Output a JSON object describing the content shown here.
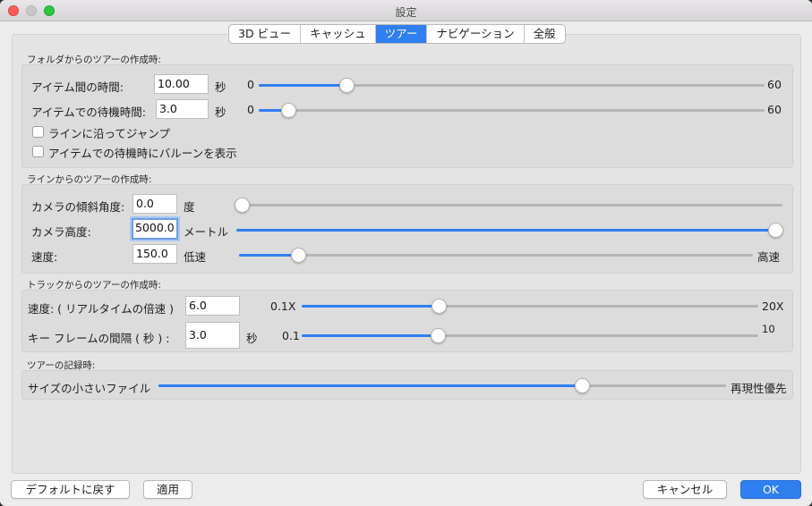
{
  "window": {
    "title": "設定"
  },
  "tabs": [
    {
      "label": "3D ビュー",
      "active": false
    },
    {
      "label": "キャッシュ",
      "active": false
    },
    {
      "label": "ツアー",
      "active": true
    },
    {
      "label": "ナビゲーション",
      "active": false
    },
    {
      "label": "全般",
      "active": false
    }
  ],
  "folder_section": {
    "title": "フォルダからのツアーの作成時:",
    "time_between": {
      "label": "アイテム間の時間:",
      "value": "10.00",
      "unit": "秒",
      "min": "0",
      "max": "60",
      "level": 10
    },
    "wait_time": {
      "label": "アイテムでの待機時間:",
      "value": "3.0",
      "unit": "秒",
      "min": "0",
      "max": "60",
      "level": 3
    },
    "jump_along_line": {
      "label": "ラインに沿ってジャンプ",
      "checked": false
    },
    "show_balloon": {
      "label": "アイテムでの待機時にバルーンを表示",
      "checked": false
    }
  },
  "line_section": {
    "title": "ラインからのツアーの作成時:",
    "tilt": {
      "label": "カメラの傾斜角度:",
      "value": "0.0",
      "unit": "度",
      "level": 0
    },
    "altitude": {
      "label": "カメラ高度:",
      "value": "5000.0",
      "unit": "メートル",
      "level": 1
    },
    "speed": {
      "label": "速度:",
      "value": "150.0",
      "min": "低速",
      "max": "高速",
      "level": 0.12
    }
  },
  "track_section": {
    "title": "トラックからのツアーの作成時:",
    "speed": {
      "label": "速度: ( リアルタイムの倍速 )",
      "value": "6.0",
      "min": "0.1X",
      "max": "20X",
      "level": 0.3
    },
    "keyframe": {
      "label": "キー フレームの間隔 ( 秒 ) :",
      "value": "3.0",
      "unit": "秒",
      "min": "0.1",
      "max": "10",
      "level": 0.3
    }
  },
  "record_section": {
    "title": "ツアーの記録時:",
    "quality": {
      "min": "サイズの小さいファイル",
      "max": "再現性優先",
      "level": 0.75
    }
  },
  "buttons": {
    "defaults": "デフォルトに戻す",
    "apply": "適用",
    "cancel": "キャンセル",
    "ok": "OK"
  },
  "colors": {
    "accent": "#2f7ff1",
    "close": "#fd5f57",
    "maximize": "#2ac940"
  }
}
